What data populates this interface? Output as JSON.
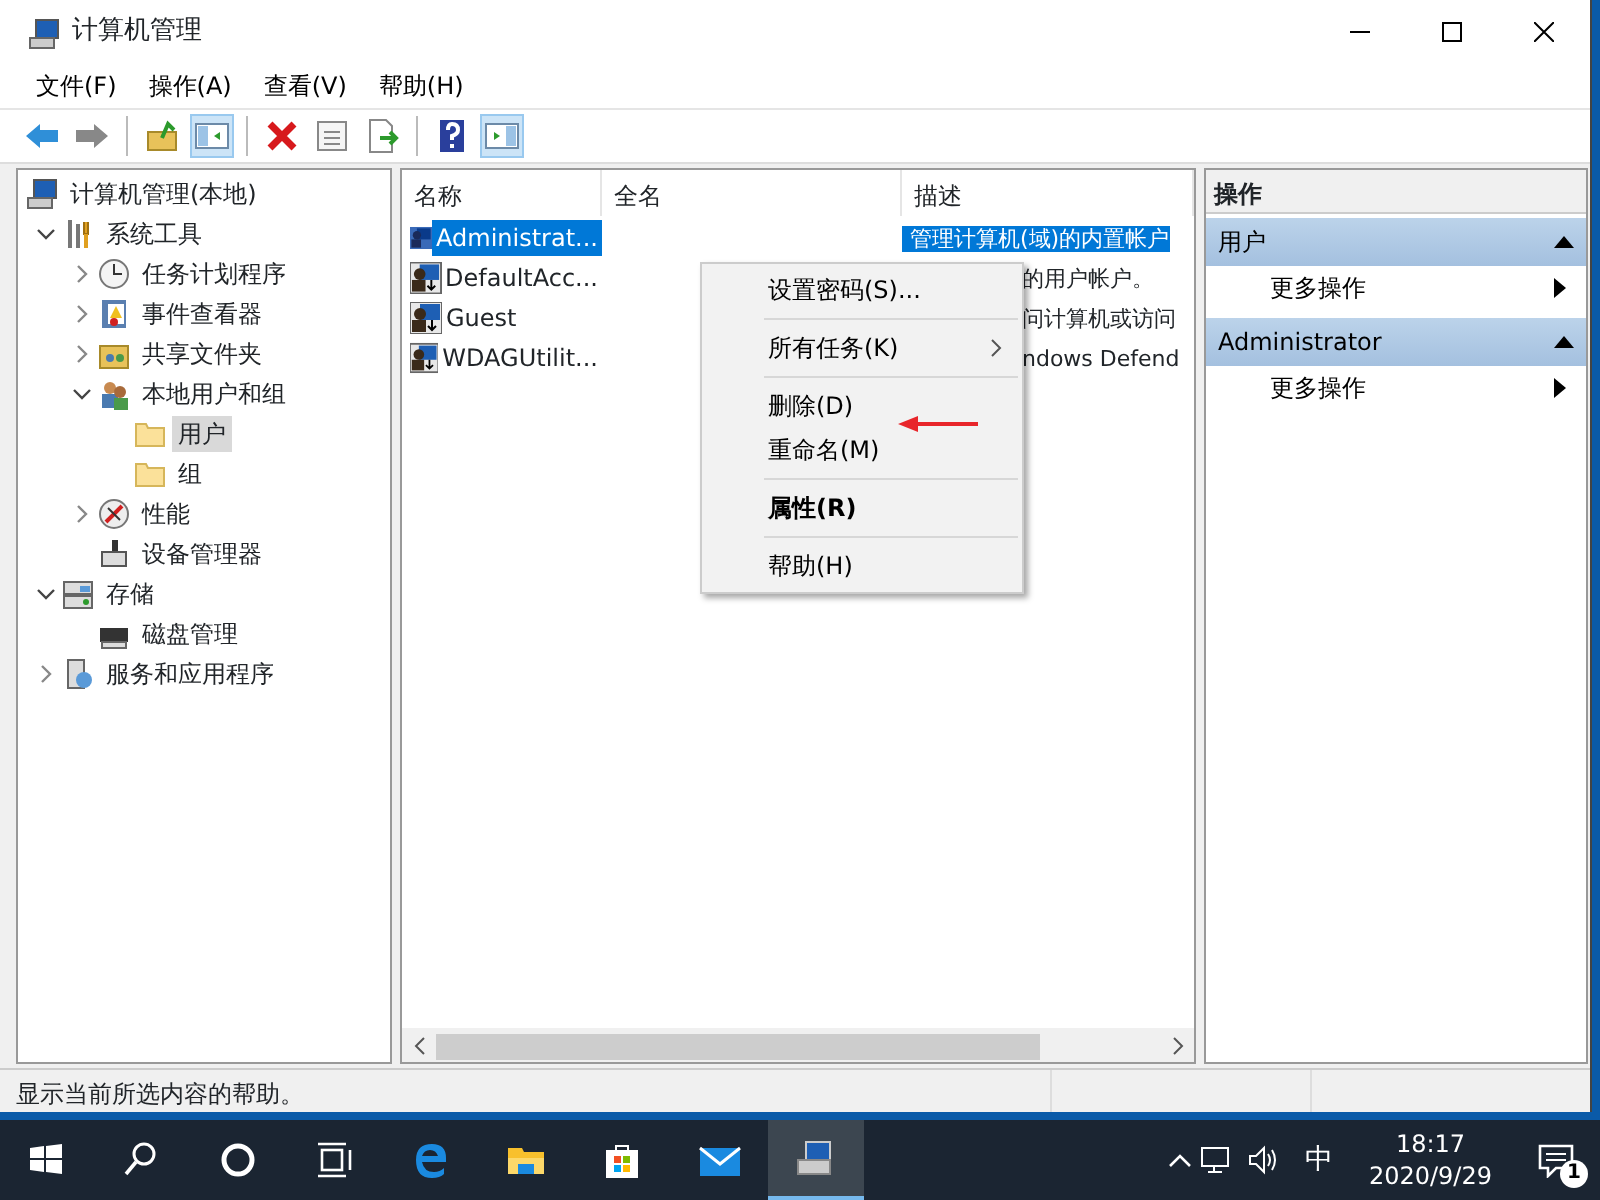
{
  "window": {
    "title": "计算机管理"
  },
  "menu": [
    {
      "label": "文件(F)"
    },
    {
      "label": "操作(A)"
    },
    {
      "label": "查看(V)"
    },
    {
      "label": "帮助(H)"
    }
  ],
  "toolbar": [
    {
      "kind": "back",
      "pressed": false
    },
    {
      "kind": "forward",
      "pressed": false
    },
    {
      "kind": "sep"
    },
    {
      "kind": "up",
      "pressed": false
    },
    {
      "kind": "tree",
      "pressed": true
    },
    {
      "kind": "sep"
    },
    {
      "kind": "delete",
      "pressed": false
    },
    {
      "kind": "properties",
      "pressed": false
    },
    {
      "kind": "export",
      "pressed": false
    },
    {
      "kind": "sep"
    },
    {
      "kind": "help",
      "pressed": false
    },
    {
      "kind": "actionpane",
      "pressed": true
    }
  ],
  "tree": [
    {
      "label": "计算机管理(本地)",
      "kind": "computer",
      "selected": false,
      "children": [
        {
          "label": "系统工具",
          "kind": "tools",
          "expanded": true,
          "selected": false,
          "children": [
            {
              "label": "任务计划程序",
              "kind": "clock",
              "expanded": false,
              "selected": false
            },
            {
              "label": "事件查看器",
              "kind": "log",
              "expanded": false,
              "selected": false
            },
            {
              "label": "共享文件夹",
              "kind": "share",
              "expanded": false,
              "selected": false
            },
            {
              "label": "本地用户和组",
              "kind": "users",
              "expanded": true,
              "selected": false,
              "children": [
                {
                  "label": "用户",
                  "kind": "folder",
                  "selected": true
                },
                {
                  "label": "组",
                  "kind": "folder",
                  "selected": false
                }
              ]
            },
            {
              "label": "性能",
              "kind": "perf",
              "expanded": false,
              "selected": false
            },
            {
              "label": "设备管理器",
              "kind": "device",
              "selected": false
            }
          ]
        },
        {
          "label": "存储",
          "kind": "storage",
          "expanded": true,
          "selected": false,
          "children": [
            {
              "label": "磁盘管理",
              "kind": "disk",
              "selected": false
            }
          ]
        },
        {
          "label": "服务和应用程序",
          "kind": "services",
          "expanded": false,
          "selected": false
        }
      ]
    }
  ],
  "table": {
    "columns": [
      "名称",
      "全名",
      "描述"
    ],
    "rows": [
      {
        "name": "Administrat...",
        "description": "管理计算机(域)的内置帐户",
        "selected": true,
        "covered": false
      },
      {
        "name": "DefaultAcc...",
        "description": "的用户帐户。",
        "selected": false,
        "covered": true
      },
      {
        "name": "Guest",
        "description": "问计算机或访问",
        "selected": false,
        "covered": true
      },
      {
        "name": "WDAGUtilit...",
        "description": "ndows Defend",
        "selected": false,
        "covered": true
      }
    ]
  },
  "context_menu": [
    {
      "kind": "item",
      "label": "设置密码(S)...",
      "default": false,
      "submenu": false
    },
    {
      "kind": "separator"
    },
    {
      "kind": "item",
      "label": "所有任务(K)",
      "default": false,
      "submenu": true
    },
    {
      "kind": "separator"
    },
    {
      "kind": "item",
      "label": "删除(D)",
      "default": false,
      "submenu": false
    },
    {
      "kind": "item",
      "label": "重命名(M)",
      "default": false,
      "submenu": false
    },
    {
      "kind": "separator"
    },
    {
      "kind": "item",
      "label": "属性(R)",
      "default": true,
      "submenu": false
    },
    {
      "kind": "separator"
    },
    {
      "kind": "item",
      "label": "帮助(H)",
      "default": false,
      "submenu": false
    }
  ],
  "actions": {
    "title": "操作",
    "sections": [
      {
        "title": "用户",
        "expanded": true,
        "items": [
          {
            "label": "更多操作"
          }
        ]
      },
      {
        "title": "Administrator",
        "expanded": true,
        "items": [
          {
            "label": "更多操作"
          }
        ]
      }
    ]
  },
  "status_bar": "显示当前所选内容的帮助。",
  "taskbar": {
    "apps": [
      {
        "kind": "start",
        "active": false
      },
      {
        "kind": "search",
        "active": false
      },
      {
        "kind": "cortana",
        "active": false
      },
      {
        "kind": "taskview",
        "active": false
      },
      {
        "kind": "edge",
        "active": false
      },
      {
        "kind": "explorer",
        "active": false
      },
      {
        "kind": "store",
        "active": false
      },
      {
        "kind": "mail",
        "active": false
      },
      {
        "kind": "compmgmt",
        "active": true
      }
    ],
    "ime": "中",
    "time": "18:17",
    "date": "2020/9/29",
    "notifications": "1"
  }
}
